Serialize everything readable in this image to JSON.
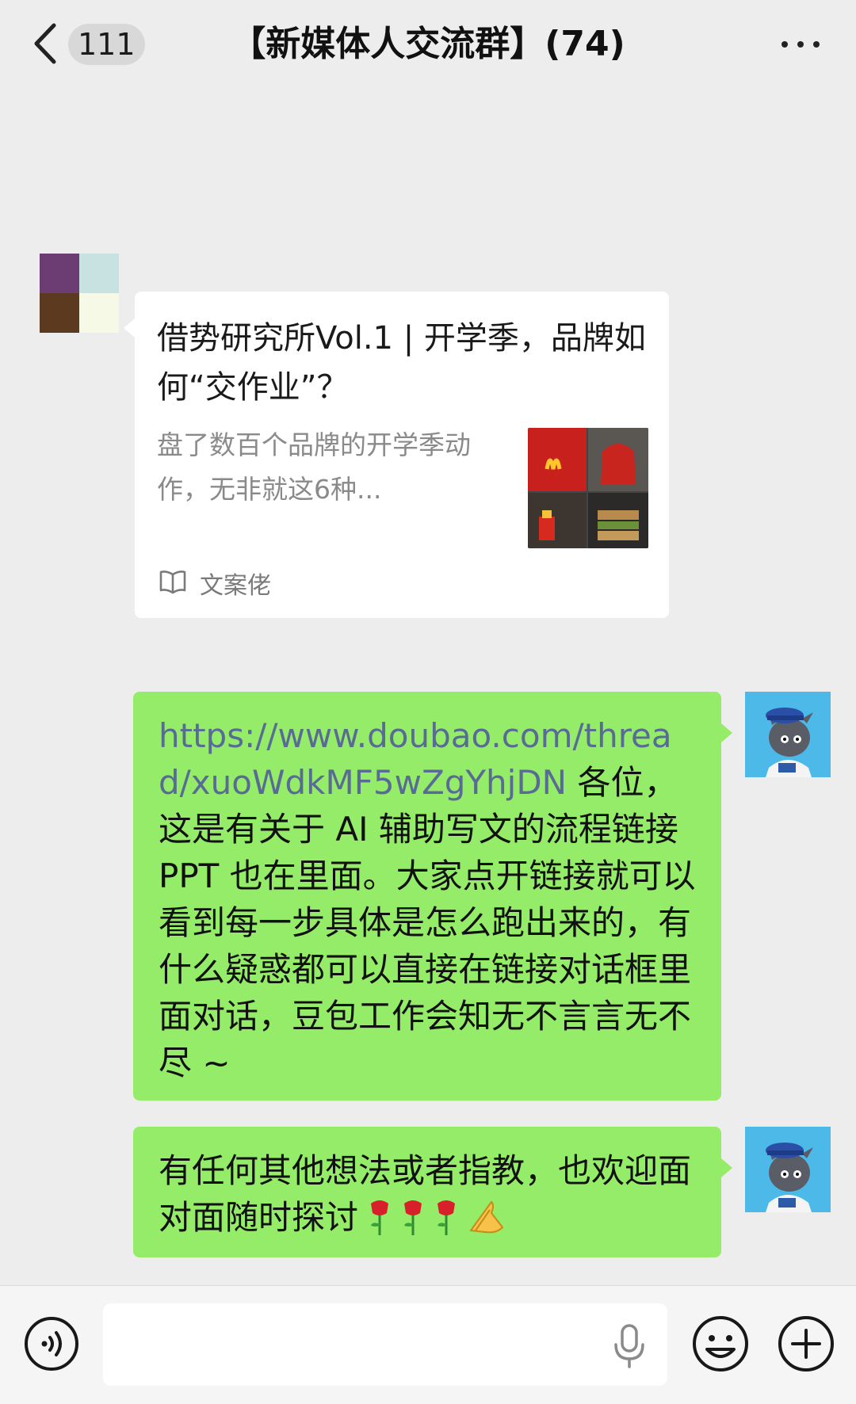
{
  "header": {
    "back_count": "111",
    "title": "【新媒体人交流群】(74)"
  },
  "link_card": {
    "title": "借势研究所Vol.1 | 开学季，品牌如何“交作业”？",
    "description": "盘了数百个品牌的开学季动作，无非就这6种...",
    "source": "文案佬"
  },
  "messages": [
    {
      "link": "https://www.doubao.com/thread/xuoWdkMF5wZgYhjDN",
      "text": " 各位，这是有关于 AI 辅助写文的流程链接 PPT 也在里面。大家点开链接就可以看到每一步具体是怎么跑出来的，有什么疑惑都可以直接在链接对话框里面对话，豆包工作会知无不言言无不尽 ~"
    },
    {
      "text": "有任何其他想法或者指教，也欢迎面对面随时探讨"
    }
  ],
  "input": {
    "placeholder": ""
  },
  "colors": {
    "background": "#ededed",
    "bubble_green": "#95ec69",
    "card_white": "#ffffff",
    "link_blue": "#576b95"
  },
  "icons": [
    "back-arrow-icon",
    "more-icon",
    "book-icon",
    "voice-icon",
    "mic-icon",
    "emoji-icon",
    "plus-icon",
    "rose-emoji",
    "pray-emoji"
  ]
}
